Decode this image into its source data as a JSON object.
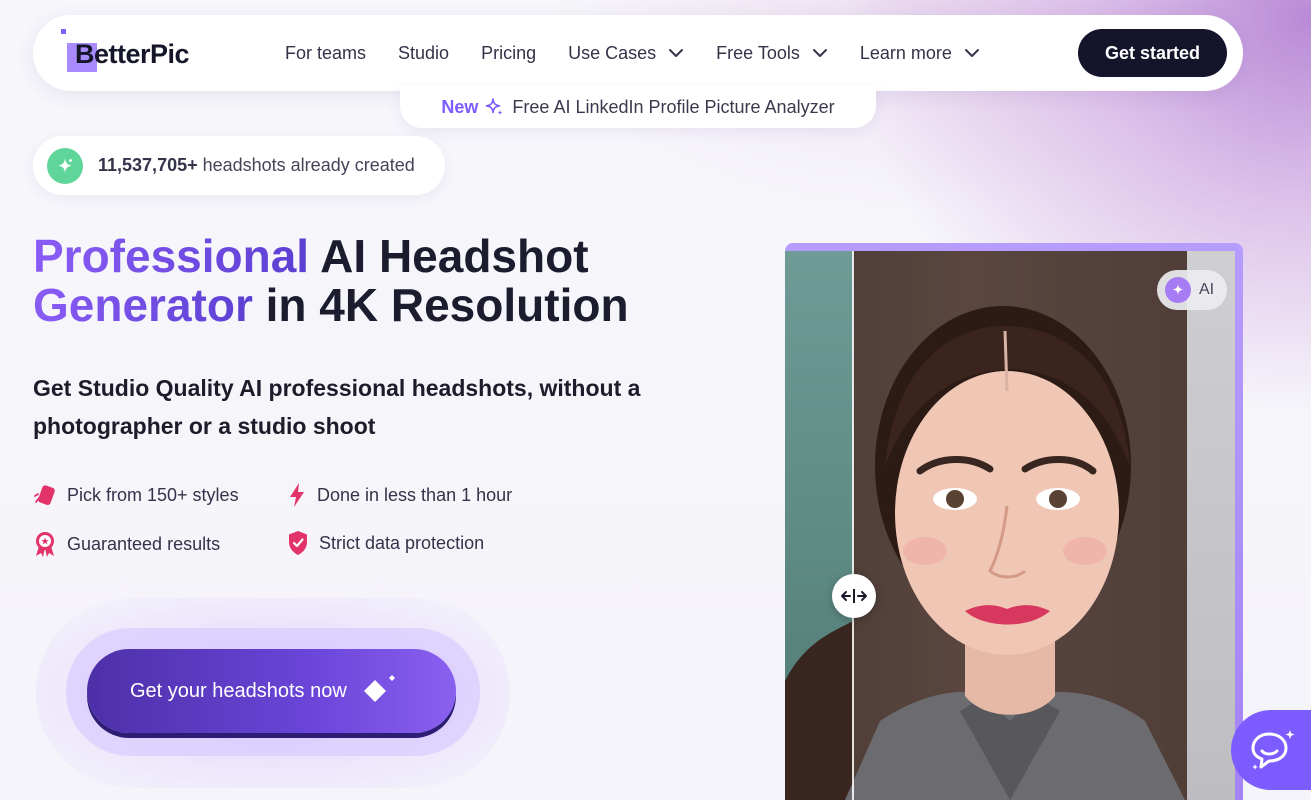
{
  "brand": {
    "name": "BetterPic",
    "accent": "#7c5cff",
    "dark": "#14142a"
  },
  "nav": {
    "items": [
      {
        "label": "For teams",
        "dropdown": false
      },
      {
        "label": "Studio",
        "dropdown": false
      },
      {
        "label": "Pricing",
        "dropdown": false
      },
      {
        "label": "Use Cases",
        "dropdown": true
      },
      {
        "label": "Free Tools",
        "dropdown": true
      },
      {
        "label": "Learn more",
        "dropdown": true
      }
    ],
    "cta_label": "Get started"
  },
  "announcement": {
    "badge": "New",
    "icon": "sparkle-icon",
    "text": "Free AI LinkedIn Profile Picture Analyzer"
  },
  "counter": {
    "count": "11,537,705+",
    "text": "headshots already created",
    "icon": "sparkle-icon"
  },
  "hero": {
    "title_line1_accent": "Professional",
    "title_line1_rest": " AI Headshot",
    "title_line2_accent": "Generator",
    "title_line2_rest": " in 4K Resolution",
    "subtitle": "Get Studio Quality AI professional headshots, without a photographer or a studio shoot"
  },
  "features": [
    {
      "icon": "tag-icon",
      "label": "Pick from 150+ styles"
    },
    {
      "icon": "lightning-icon",
      "label": "Done in less than 1 hour"
    },
    {
      "icon": "award-ribbon-icon",
      "label": "Guaranteed results"
    },
    {
      "icon": "shield-check-icon",
      "label": "Strict data protection"
    }
  ],
  "cta": {
    "label": "Get your headshots now",
    "icon": "sparkle-diamond-icon"
  },
  "compare": {
    "badge_label": "AI",
    "handle_icon": "arrows-left-right-icon"
  },
  "chat": {
    "icon": "chat-bubble-icon"
  }
}
